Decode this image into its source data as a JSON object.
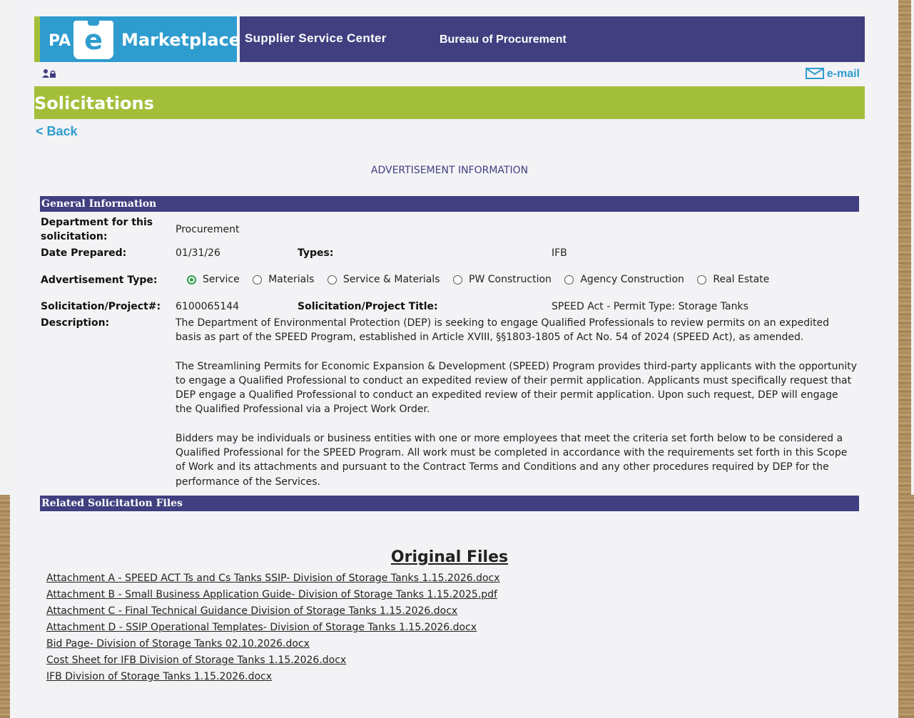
{
  "header": {
    "logo_pa": "PA",
    "logo_e": "e",
    "logo_marketplace": "Marketplace",
    "nav_supplier": "Supplier Service Center",
    "nav_bureau": "Bureau of Procurement",
    "email": "e-mail"
  },
  "page": {
    "title": "Solicitations",
    "back": "< Back",
    "section_heading": "ADVERTISEMENT INFORMATION"
  },
  "general": {
    "bar": "General Information",
    "dept_label": "Department for this solicitation:",
    "dept_value": "Procurement",
    "date_label": "Date Prepared:",
    "date_value": "01/31/26",
    "types_label": "Types:",
    "types_value": "IFB",
    "adtype_label": "Advertisement Type:",
    "adtype_options": [
      "Service",
      "Materials",
      "Service & Materials",
      "PW Construction",
      "Agency Construction",
      "Real Estate"
    ],
    "adtype_selected": "Service",
    "sol_label": "Solicitation/Project#:",
    "sol_value": "6100065144",
    "title_label": "Solicitation/Project Title:",
    "title_value": "SPEED Act - Permit Type: Storage Tanks",
    "desc_label": "Description:",
    "desc_p1": "The Department of Environmental Protection (DEP) is seeking to engage Qualified Professionals to review permits on an expedited basis as part of the SPEED Program, established in Article XVIII, §§1803-1805 of Act No. 54 of 2024 (SPEED Act), as amended.",
    "desc_p2": "The Streamlining Permits for Economic Expansion & Development (SPEED) Program provides third-party applicants with the opportunity to engage a Qualified Professional to conduct an expedited review of their permit application. Applicants must specifically request that DEP engage a Qualified Professional to conduct an expedited review of their permit application. Upon such request, DEP will engage the Qualified Professional via a Project Work Order.",
    "desc_p3": "Bidders may be individuals or business entities with one or more employees that meet the criteria set forth below to be considered a Qualified Professional for the SPEED Program. All work must be completed in accordance with the requirements set forth in this Scope of Work and its attachments and pursuant to the Contract Terms and Conditions and any other procedures required by DEP for the performance of the Services."
  },
  "related": {
    "bar": "Related Solicitation Files",
    "original_title": "Original Files",
    "files": [
      "Attachment A - SPEED ACT Ts and Cs Tanks SSIP- Division of Storage Tanks 1.15.2026.docx",
      "Attachment B - Small Business Application Guide- Division of Storage Tanks 1.15.2025.pdf",
      "Attachment C - Final Technical Guidance Division of Storage Tanks 1.15.2026.docx",
      "Attachment D - SSIP Operational Templates- Division of Storage Tanks 1.15.2026.docx",
      "Bid Page- Division of Storage Tanks 02.10.2026.docx",
      "Cost Sheet for IFB Division of Storage Tanks 1.15.2026.docx",
      "IFB Division of Storage Tanks 1.15.2026.docx"
    ]
  },
  "colors": {
    "navy": "#413f80",
    "blue": "#2e9ccf",
    "green": "#a3bf3a"
  },
  "icons": [
    "user-lock-icon",
    "envelope-icon"
  ]
}
